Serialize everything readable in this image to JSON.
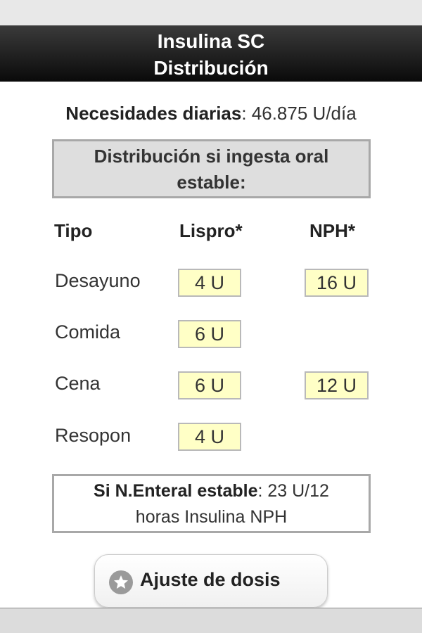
{
  "header": {
    "title_line1": "Insulina SC",
    "title_line2": "Distribución"
  },
  "needs": {
    "label": "Necesidades diarias",
    "value": ": 46.875 U/día"
  },
  "oral_box": {
    "line1": "Distribución si ingesta oral",
    "line2": "estable:"
  },
  "table": {
    "headers": [
      "Tipo",
      "Lispro*",
      "NPH*"
    ],
    "rows": [
      {
        "label": "Desayuno",
        "lispro": "4 U",
        "nph": "16 U"
      },
      {
        "label": "Comida",
        "lispro": "6 U",
        "nph": ""
      },
      {
        "label": "Cena",
        "lispro": "6 U",
        "nph": "12 U"
      },
      {
        "label": "Resopon",
        "lispro": "4 U",
        "nph": ""
      }
    ]
  },
  "enteral_box": {
    "label": "Si N.Enteral estable",
    "value": ": 23 U/12",
    "line2": "horas Insulina NPH"
  },
  "button": {
    "label": "Ajuste de dosis",
    "icon": "star-icon"
  }
}
